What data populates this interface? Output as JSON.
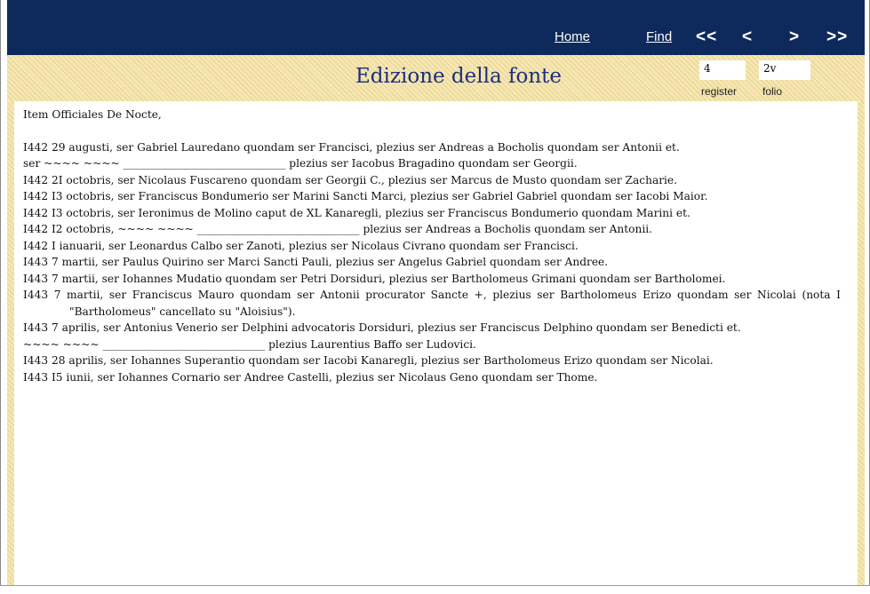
{
  "nav": {
    "home": "Home",
    "find": "Find",
    "first": "<<",
    "prev": "<",
    "next": ">",
    "last": ">>"
  },
  "header": {
    "title": "Edizione della fonte",
    "register_value": "4",
    "register_label": "register",
    "folio_value": "2v",
    "folio_label": "folio"
  },
  "document": {
    "heading": "Item Officiales De Nocte,",
    "entries": [
      "I442 29 augusti, ser Gabriel Lauredano quondam ser Francisci, plezius ser Andreas a Bocholis quondam ser Antonii et.",
      "ser ~~~~ ~~~~ ______________________________ plezius ser Iacobus Bragadino quondam ser Georgii.",
      "I442 2I octobris, ser Nicolaus Fuscareno quondam ser Georgii C., plezius ser Marcus de Musto quondam ser Zacharie.",
      "I442 I3 octobris, ser Franciscus Bondumerio ser Marini Sancti Marci, plezius ser Gabriel Gabriel quondam ser Iacobi Maior.",
      "I442 I3 octobris, ser Ieronimus de Molino caput de XL Kanaregli, plezius ser Franciscus Bondumerio quondam Marini et.",
      "I442 I2 octobris, ~~~~ ~~~~ ______________________________ plezius ser Andreas a Bocholis quondam ser Antonii.",
      "I442 I ianuarii, ser Leonardus Calbo ser Zanoti, plezius ser Nicolaus Civrano quondam ser Francisci.",
      "I443 7 martii, ser Paulus Quirino ser Marci Sancti Pauli, plezius ser Angelus Gabriel quondam ser Andree.",
      "I443 7 martii, ser Iohannes Mudatio quondam ser Petri Dorsiduri, plezius ser Bartholomeus Grimani quondam ser Bartholomei.",
      "I443 7 martii, ser Franciscus Mauro quondam ser Antonii procurator Sancte +, plezius ser Bartholomeus Erizo quondam ser Nicolai (nota I \"Bartholomeus\" cancellato su \"Aloisius\").",
      "I443 7 aprilis, ser Antonius Venerio ser Delphini advocatoris Dorsiduri, plezius ser Franciscus Delphino quondam ser Benedicti et.",
      "~~~~ ~~~~ ______________________________ plezius Laurentius Baffo ser Ludovici.",
      "I443 28 aprilis, ser Iohannes Superantio quondam ser Iacobi Kanaregli, plezius ser Bartholomeus Erizo quondam ser Nicolai.",
      "I443 I5 iunii, ser Iohannes Cornario ser Andree Castelli, plezius ser Nicolaus Geno quondam ser Thome."
    ]
  }
}
